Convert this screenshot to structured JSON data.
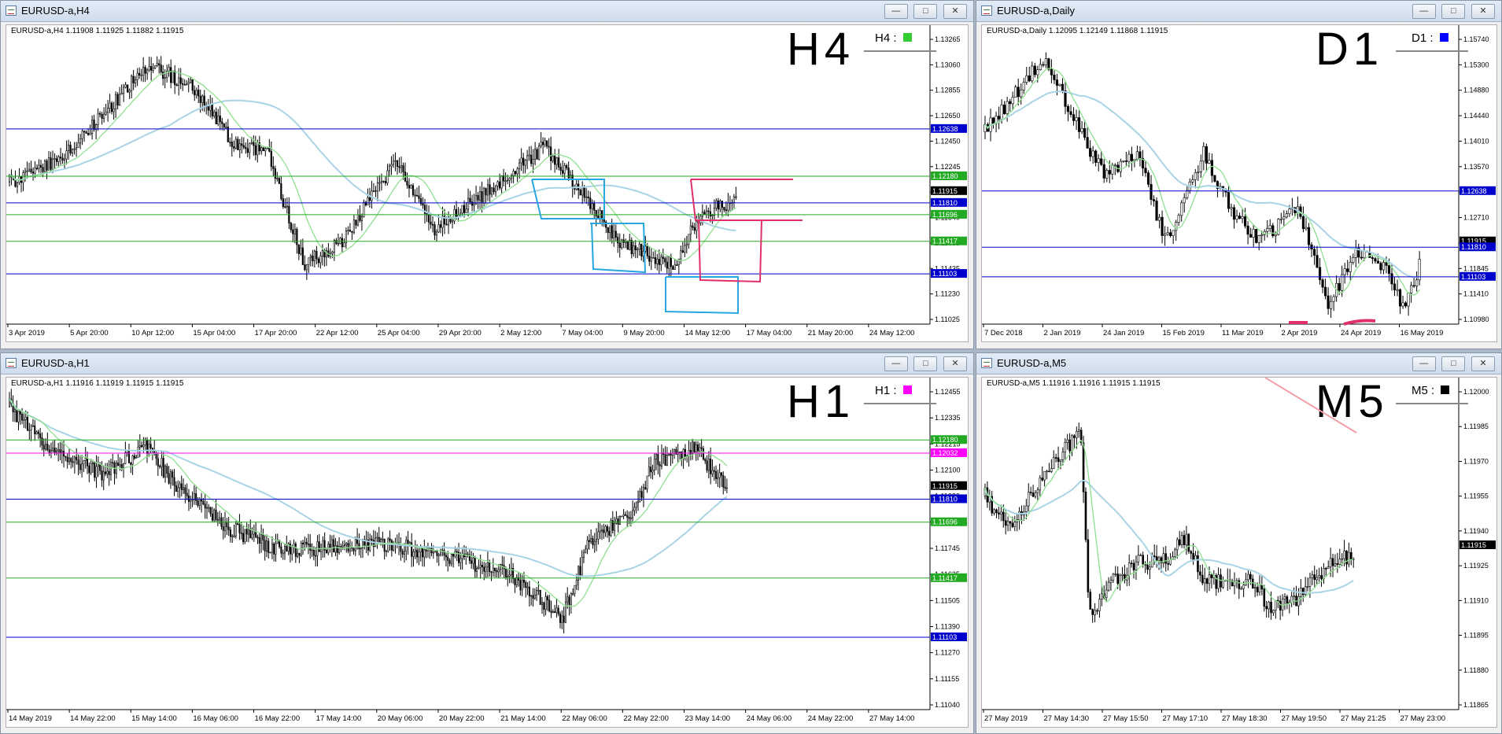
{
  "windows": [
    {
      "id": "h4",
      "title": "EURUSD-a,H4",
      "info": "EURUSD-a,H4  1.11908 1.11925 1.11882 1.11915",
      "handwritten": "H4",
      "badge": {
        "label": "H4 :",
        "color": "#33cc33"
      },
      "price_labels": [
        "1.13265",
        "1.13060",
        "1.12855",
        "1.12650",
        "1.12450",
        "1.12245",
        "1.12045",
        "1.11840",
        "1.11635",
        "1.11435",
        "1.11230",
        "1.11025"
      ],
      "xlabels": [
        "3 Apr 2019",
        "5 Apr 20:00",
        "10 Apr 12:00",
        "15 Apr 04:00",
        "17 Apr 20:00",
        "22 Apr 12:00",
        "25 Apr 04:00",
        "29 Apr 20:00",
        "2 May 12:00",
        "7 May 04:00",
        "9 May 20:00",
        "14 May 12:00",
        "17 May 04:00",
        "21 May 20:00",
        "24 May 12:00"
      ],
      "levels": [
        {
          "value": "1.12638",
          "color": "#0000cc"
        },
        {
          "value": "1.12180",
          "color": "#22aa22"
        },
        {
          "value": "1.11915",
          "color": "#000000"
        },
        {
          "value": "1.11810",
          "color": "#0000cc"
        },
        {
          "value": "1.11696",
          "color": "#22aa22"
        },
        {
          "value": "1.11417",
          "color": "#22aa22"
        },
        {
          "value": "1.11103",
          "color": "#0000cc"
        }
      ]
    },
    {
      "id": "d1",
      "title": "EURUSD-a,Daily",
      "info": "EURUSD-a,Daily  1.12095 1.12149 1.11868 1.11915",
      "handwritten": "D1",
      "badge": {
        "label": "D1 :",
        "color": "#0000ff"
      },
      "price_labels": [
        "1.15740",
        "1.15300",
        "1.14880",
        "1.14440",
        "1.14010",
        "1.13570",
        "1.13140",
        "1.12710",
        "1.12280",
        "1.11845",
        "1.11410",
        "1.10980"
      ],
      "xlabels": [
        "7 Dec 2018",
        "2 Jan 2019",
        "24 Jan 2019",
        "15 Feb 2019",
        "11 Mar 2019",
        "2 Apr 2019",
        "24 Apr 2019",
        "16 May 2019"
      ],
      "levels": [
        {
          "value": "1.12638",
          "color": "#0000cc"
        },
        {
          "value": "1.11915",
          "color": "#000000"
        },
        {
          "value": "1.11810",
          "color": "#0000cc"
        },
        {
          "value": "1.11103",
          "color": "#0000cc"
        }
      ]
    },
    {
      "id": "h1",
      "title": "EURUSD-a,H1",
      "info": "EURUSD-a,H1  1.11916 1.11919 1.11915 1.11915",
      "handwritten": "H1",
      "badge": {
        "label": "H1 :",
        "color": "#ff00ff"
      },
      "price_labels": [
        "1.12455",
        "1.12335",
        "1.12215",
        "1.12100",
        "1.11980",
        "1.11860",
        "1.11745",
        "1.11625",
        "1.11505",
        "1.11390",
        "1.11270",
        "1.11155",
        "1.11040"
      ],
      "xlabels": [
        "14 May 2019",
        "14 May 22:00",
        "15 May 14:00",
        "16 May 06:00",
        "16 May 22:00",
        "17 May 14:00",
        "20 May 06:00",
        "20 May 22:00",
        "21 May 14:00",
        "22 May 06:00",
        "22 May 22:00",
        "23 May 14:00",
        "24 May 06:00",
        "24 May 22:00",
        "27 May 14:00"
      ],
      "levels": [
        {
          "value": "1.12180",
          "color": "#22aa22"
        },
        {
          "value": "1.12032",
          "color": "#ff00ff"
        },
        {
          "value": "1.11915",
          "color": "#000000"
        },
        {
          "value": "1.11810",
          "color": "#0000cc"
        },
        {
          "value": "1.11696",
          "color": "#22aa22"
        },
        {
          "value": "1.11417",
          "color": "#22aa22"
        },
        {
          "value": "1.11103",
          "color": "#0000cc"
        }
      ]
    },
    {
      "id": "m5",
      "title": "EURUSD-a,M5",
      "info": "EURUSD-a,M5  1.11916 1.11916 1.11915 1.11915",
      "handwritten": "M5",
      "badge": {
        "label": "M5 :",
        "color": "#000000"
      },
      "price_labels": [
        "1.12000",
        "1.11985",
        "1.11970",
        "1.11955",
        "1.11940",
        "1.11925",
        "1.11910",
        "1.11895",
        "1.11880",
        "1.11865"
      ],
      "xlabels": [
        "27 May 2019",
        "27 May 14:30",
        "27 May 15:50",
        "27 May 17:10",
        "27 May 18:30",
        "27 May 19:50",
        "27 May 21:25",
        "27 May 23:00"
      ],
      "levels": [
        {
          "value": "1.11915",
          "color": "#000000"
        }
      ]
    }
  ]
}
